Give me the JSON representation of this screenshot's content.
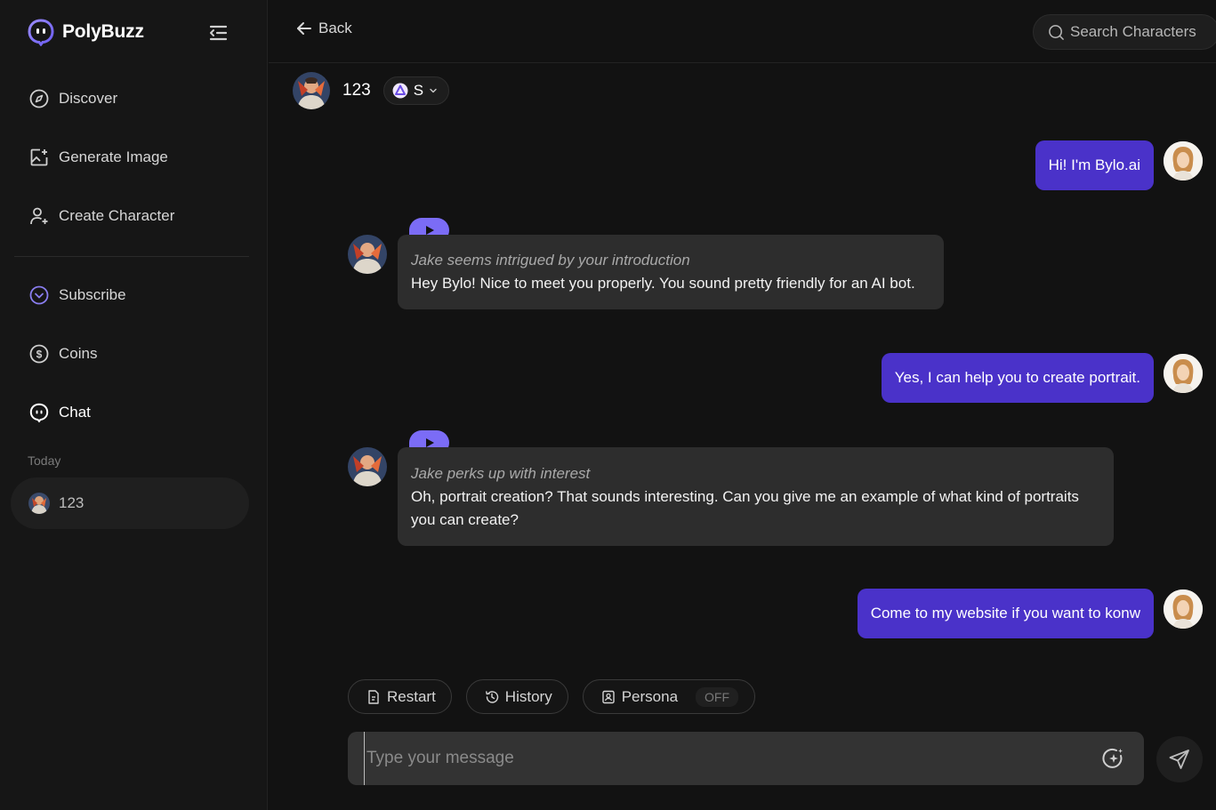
{
  "app": {
    "name": "PolyBuzz"
  },
  "sidebar": {
    "items": [
      {
        "label": "Discover",
        "icon": "compass-icon"
      },
      {
        "label": "Generate Image",
        "icon": "image-plus-icon"
      },
      {
        "label": "Create Character",
        "icon": "user-plus-icon"
      },
      {
        "label": "Subscribe",
        "icon": "subscribe-icon"
      },
      {
        "label": "Coins",
        "icon": "coin-icon"
      },
      {
        "label": "Chat",
        "icon": "chat-bubble-icon"
      }
    ],
    "section_label": "Today",
    "history": [
      {
        "label": "123"
      }
    ]
  },
  "header": {
    "back_label": "Back",
    "search_placeholder": "Search Characters"
  },
  "character": {
    "name": "123",
    "model_label": "S"
  },
  "messages": [
    {
      "role": "user",
      "text": "Hi! I'm Bylo.ai"
    },
    {
      "role": "bot",
      "action": "Jake seems intrigued by your introduction",
      "text": "Hey Bylo! Nice to meet you properly. You sound pretty friendly for an AI bot."
    },
    {
      "role": "user",
      "text": "Yes, I can help you to create portrait."
    },
    {
      "role": "bot",
      "action": "Jake perks up with interest",
      "text": "Oh, portrait creation? That sounds interesting. Can you give me an example of what kind of portraits you can create?"
    },
    {
      "role": "user",
      "text": "Come to my website if you want to konw"
    }
  ],
  "controls": {
    "restart_label": "Restart",
    "history_label": "History",
    "persona_label": "Persona",
    "persona_state": "OFF"
  },
  "composer": {
    "placeholder": "Type your message"
  },
  "colors": {
    "accent": "#4a32c9",
    "play": "#7b6cf6",
    "bot_bubble": "#2d2d2d"
  }
}
